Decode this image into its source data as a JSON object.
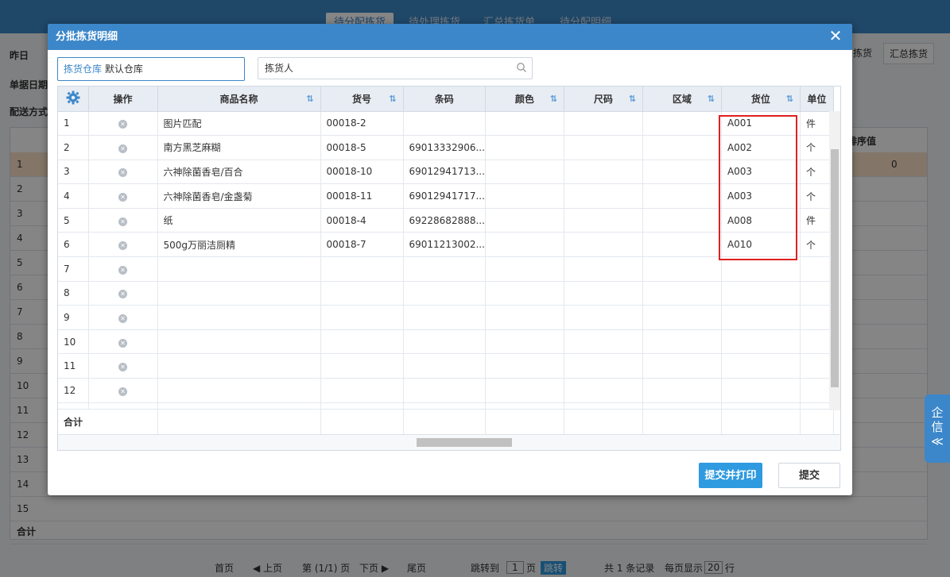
{
  "background": {
    "tabs": [
      "待分配拣货",
      "待处理拣货",
      "汇总拣货单",
      "待分配明细"
    ],
    "left_labels": [
      "昨日",
      "单据日期",
      "配送方式"
    ],
    "right_buttons": [
      "拣货",
      "汇总拣货"
    ],
    "sort_column_label": "排序值",
    "row_numbers": [
      "1",
      "2",
      "3",
      "4",
      "5",
      "6",
      "7",
      "8",
      "9",
      "10",
      "11",
      "12",
      "13",
      "14",
      "15"
    ],
    "highlight_value": "0",
    "total_label": "合计",
    "pager": {
      "first": "首页",
      "prev": "◀ 上页",
      "page_info": "第 (1/1) 页",
      "next": "下页 ▶",
      "last": "尾页",
      "jump_to": "跳转到",
      "jump_page": "1",
      "jump_unit": "页",
      "jump_btn": "跳转",
      "records": "共 1 条记录",
      "per_page": "每页显示",
      "per_page_value": "20",
      "per_page_unit": "行"
    }
  },
  "dialog": {
    "title": "分批拣货明细",
    "close_label": "✕",
    "warehouse": {
      "label": "拣货仓库",
      "value": "默认仓库"
    },
    "picker": {
      "placeholder": "拣货人"
    },
    "columns": [
      "",
      "操作",
      "商品名称",
      "货号",
      "条码",
      "颜色",
      "尺码",
      "区域",
      "货位",
      "单位"
    ],
    "rows": [
      {
        "no": "1",
        "name": "图片匹配",
        "sku": "00018-2",
        "barcode": "",
        "color": "",
        "size": "",
        "zone": "",
        "location": "A001",
        "unit": "件"
      },
      {
        "no": "2",
        "name": "南方黑芝麻糊",
        "sku": "00018-5",
        "barcode": "69013332906...",
        "color": "",
        "size": "",
        "zone": "",
        "location": "A002",
        "unit": "个"
      },
      {
        "no": "3",
        "name": "六神除菌香皂/百合",
        "sku": "00018-10",
        "barcode": "69012941713...",
        "color": "",
        "size": "",
        "zone": "",
        "location": "A003",
        "unit": "个"
      },
      {
        "no": "4",
        "name": "六神除菌香皂/金盏菊",
        "sku": "00018-11",
        "barcode": "69012941717...",
        "color": "",
        "size": "",
        "zone": "",
        "location": "A003",
        "unit": "个"
      },
      {
        "no": "5",
        "name": "纸",
        "sku": "00018-4",
        "barcode": "69228682888...",
        "color": "",
        "size": "",
        "zone": "",
        "location": "A008",
        "unit": "件"
      },
      {
        "no": "6",
        "name": "500g万丽洁厕精",
        "sku": "00018-7",
        "barcode": "69011213002...",
        "color": "",
        "size": "",
        "zone": "",
        "location": "A010",
        "unit": "个"
      },
      {
        "no": "7",
        "name": "",
        "sku": "",
        "barcode": "",
        "color": "",
        "size": "",
        "zone": "",
        "location": "",
        "unit": ""
      },
      {
        "no": "8",
        "name": "",
        "sku": "",
        "barcode": "",
        "color": "",
        "size": "",
        "zone": "",
        "location": "",
        "unit": ""
      },
      {
        "no": "9",
        "name": "",
        "sku": "",
        "barcode": "",
        "color": "",
        "size": "",
        "zone": "",
        "location": "",
        "unit": ""
      },
      {
        "no": "10",
        "name": "",
        "sku": "",
        "barcode": "",
        "color": "",
        "size": "",
        "zone": "",
        "location": "",
        "unit": ""
      },
      {
        "no": "11",
        "name": "",
        "sku": "",
        "barcode": "",
        "color": "",
        "size": "",
        "zone": "",
        "location": "",
        "unit": ""
      },
      {
        "no": "12",
        "name": "",
        "sku": "",
        "barcode": "",
        "color": "",
        "size": "",
        "zone": "",
        "location": "",
        "unit": ""
      }
    ],
    "total_label": "合计",
    "buttons": {
      "submit_print": "提交并打印",
      "submit": "提交"
    }
  },
  "side_widget": {
    "line1": "企",
    "line2": "信",
    "line3": "≪"
  },
  "colors": {
    "primary": "#3c87c9",
    "highlight_box": "#e02020",
    "button": "#2e9ae0"
  }
}
